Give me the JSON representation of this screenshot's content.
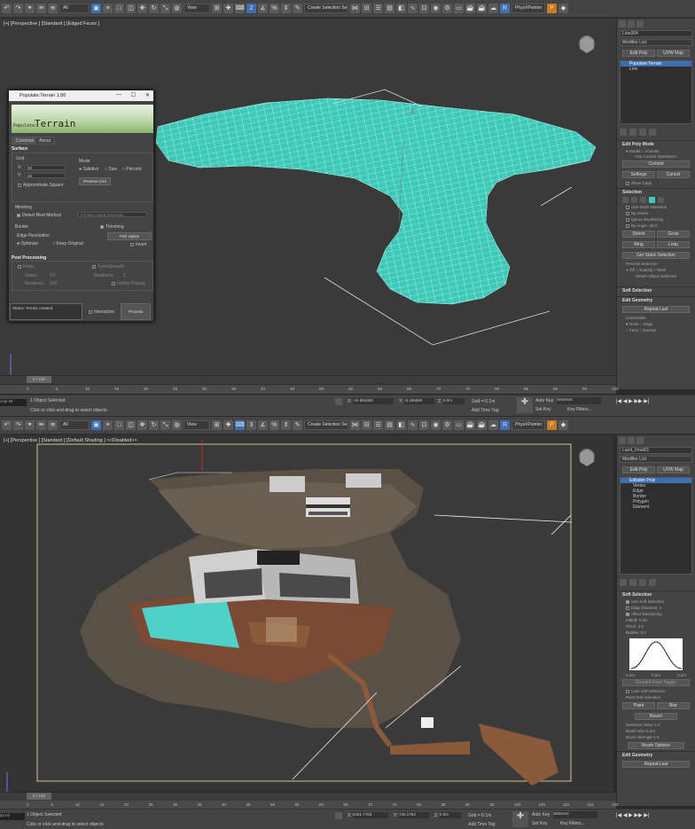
{
  "top": {
    "toolbar": {
      "selection_filter": "All",
      "view_dropdown": "View",
      "named_selection": "Create Selection Se",
      "tab_label": "PhysXPainter"
    },
    "viewport_label": "[+] [Perspective ] [Standard ] [Edged Faces ]",
    "panel": {
      "object_name": "Line004",
      "modifier_list": "Modifier List",
      "btn1": "Edit Poly",
      "btn2": "UVW Map",
      "stack": [
        "Populate:Terrain",
        "Line"
      ],
      "edit_poly_mode": "Edit Poly Mode",
      "model": "Model",
      "animate": "Animate",
      "no_op": "<No Current Operation>",
      "commit": "Commit",
      "settings": "Settings",
      "cancel": "Cancel",
      "show_cage": "Show Cage",
      "selection": "Selection",
      "use_stack": "Use Stack Selection",
      "by_vertex": "By Vertex",
      "ignore_bf": "Ignore Backfacing",
      "by_angle": "By Angle:",
      "angle_val": "45.0",
      "shrink": "Shrink",
      "grow": "Grow",
      "ring": "Ring",
      "loop": "Loop",
      "get_stack": "Get Stack Selection",
      "preview_sel": "Preview Selection",
      "off": "Off",
      "subobj": "SubObj",
      "multi": "Multi",
      "whole_obj": "Whole Object Selected",
      "soft_sel": "Soft Selection",
      "edit_geom": "Edit Geometry",
      "repeat_last": "Repeat Last",
      "constraints": "Constraints",
      "none": "None",
      "edge": "Edge",
      "face": "Face",
      "normal": "Normal"
    },
    "dialog": {
      "title": "Populate:Terrain 1.86",
      "banner_small": "Populate:",
      "banner_big": "Terrain",
      "tabs": [
        "Common",
        "About"
      ],
      "surface": "Surface",
      "grid": "Grid",
      "x_label": "X:",
      "x_val": "50",
      "y_label": "Y:",
      "y_val": "50",
      "approx_square": "Approximate Square",
      "mode": "Mode",
      "subdivs": "Subdivs",
      "size": "Size",
      "percent": "Percent",
      "preview_grid": "Preview Grid",
      "meshing": "Meshing",
      "detect_best": "Detect Best Method",
      "fill_method": "Fill with Island Detection",
      "border": "Border",
      "edge_resolution": "Edge Resolution",
      "optimize": "Optimize",
      "keep_original": "Keep Original",
      "trimming": "Trimming",
      "pick_spline": "Pick Spline",
      "invert": "Invert",
      "post_processing": "Post Processing",
      "relax": "Relax",
      "value": "Value:",
      "value_val": "0.5",
      "iterations": "Iterations:",
      "iter_val": "100",
      "turbosmooth": "TurboSmooth",
      "ts_iter": "Iterations:",
      "ts_iter_val": "1",
      "isoline": "Isoline Display",
      "status": "Status: Terrain created.",
      "interactive": "Interactive",
      "process": "Process"
    },
    "timeline": "0 / 100",
    "ruler": [
      "0",
      "5",
      "10",
      "15",
      "20",
      "25",
      "30",
      "35",
      "40",
      "45",
      "50",
      "55",
      "60",
      "65",
      "70",
      "75",
      "80",
      "85",
      "90",
      "95",
      "100"
    ],
    "status": {
      "selected": "1 Object Selected",
      "hint": "Click or click-and-drag to select objects",
      "x": "-24.981559",
      "y": "-5.185669",
      "z": "0.0m",
      "grid": "Grid = 0.1m",
      "add_time_tag": "Add Time Tag",
      "auto_key": "Auto Key",
      "set_key": "Set Key",
      "key_sel": "Selected",
      "key_filters": "Key Filters...",
      "script": "cript Mi"
    }
  },
  "bottom": {
    "toolbar": {
      "selection_filter": "All",
      "view_dropdown": "View",
      "named_selection": "Create Selection Se",
      "tab_label": "PhysXPainter"
    },
    "viewport_label": "[+] [Perspective ] [Standard ] [Default Shading ]  <<Disabled>>",
    "panel": {
      "object_name": "Land_Final01",
      "modifier_list": "Modifier List",
      "btn1": "Edit Poly",
      "btn2": "UVW Map",
      "stack": [
        "Editable Poly",
        "Vertex",
        "Edge",
        "Border",
        "Polygon",
        "Element"
      ],
      "soft_sel": "Soft Selection",
      "use_soft": "Use Soft Selection",
      "edge_dist": "Edge Distance:",
      "edge_dist_val": "1",
      "affect_bf": "Affect Backfacing",
      "falloff": "Falloff:",
      "falloff_val": "0.2m",
      "pinch": "Pinch:",
      "pinch_val": "0.0",
      "bubble": "Bubble:",
      "bubble_val": "0.0",
      "curve_left": "0.2m",
      "curve_mid": "0.0m",
      "curve_right": "0.2m",
      "shaded_face": "Shaded Face Toggle",
      "lock_soft": "Lock Soft Selection",
      "paint_soft": "Paint Soft Selection",
      "paint": "Paint",
      "blur": "Blur",
      "revert": "Revert",
      "sel_value": "Selection Value",
      "sel_value_val": "1.0",
      "brush_size": "Brush Size",
      "brush_size_val": "0.2m",
      "brush_strength": "Brush Strength",
      "brush_strength_val": "1.0",
      "brush_options": "Brush Options",
      "edit_geom": "Edit Geometry",
      "repeat_last": "Repeat Last"
    },
    "timeline": "0 / 120",
    "ruler": [
      "0",
      "5",
      "10",
      "15",
      "20",
      "25",
      "30",
      "35",
      "40",
      "45",
      "50",
      "55",
      "60",
      "65",
      "70",
      "75",
      "80",
      "85",
      "90",
      "95",
      "100",
      "105",
      "110",
      "115",
      "120"
    ],
    "status": {
      "selected": "1 Object Selected",
      "hint": "Click or click-and-drag to select objects",
      "x": "8481.7763",
      "y": "726.1763",
      "z": "0.0m",
      "grid": "Grid = 0.1m",
      "add_time_tag": "Add Time Tag",
      "auto_key": "Auto Key",
      "set_key": "Set Key",
      "key_sel": "Selected",
      "key_filters": "Key Filters...",
      "script": "ipt Mi"
    }
  }
}
